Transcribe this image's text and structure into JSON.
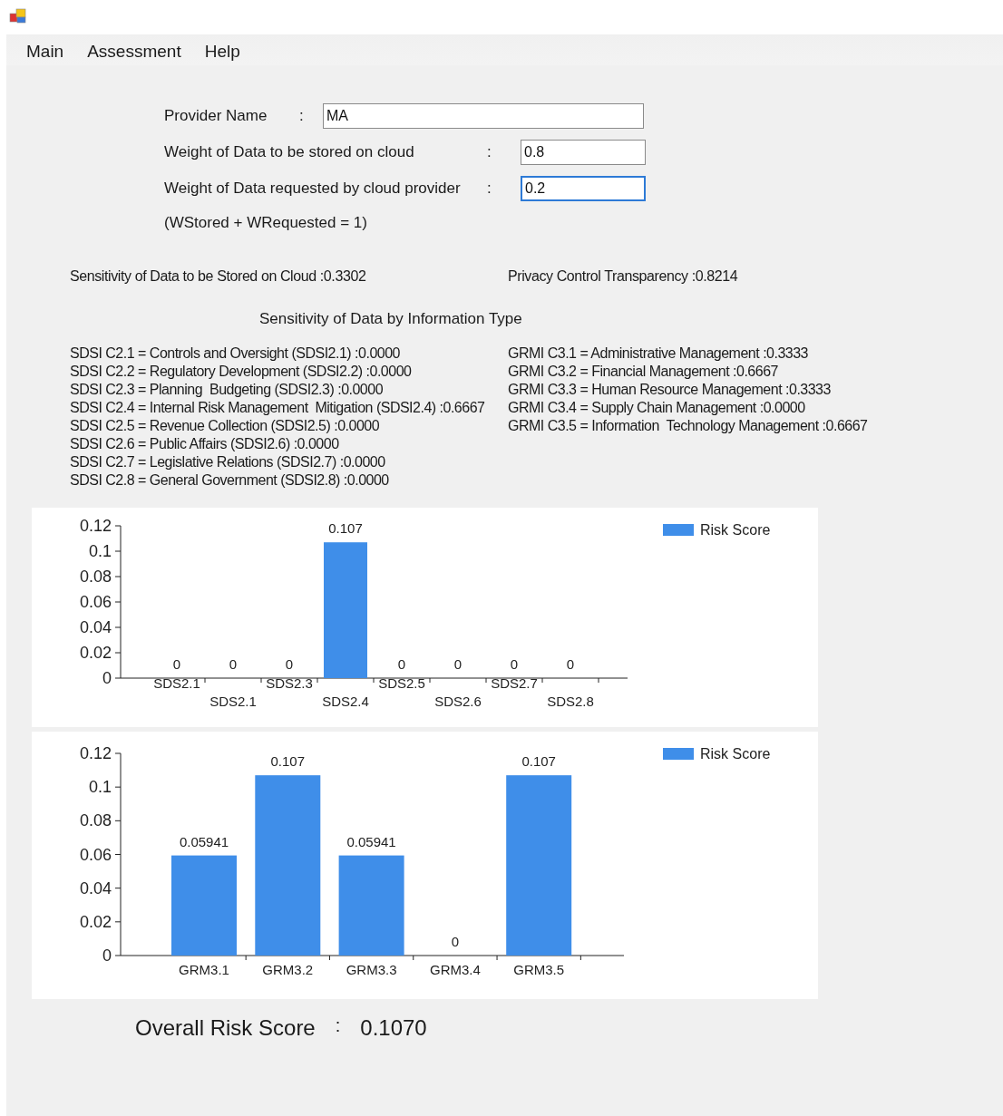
{
  "menu": [
    {
      "label": "Main"
    },
    {
      "label": "Assessment"
    },
    {
      "label": "Help"
    }
  ],
  "form": {
    "fields": [
      {
        "label": "Provider Name",
        "separator": ":",
        "value": "MA",
        "focused": false
      },
      {
        "label": "Weight of Data to be stored on cloud",
        "separator": ":",
        "value": "0.8",
        "focused": false
      },
      {
        "label": "Weight of Data requested by cloud provider",
        "separator": ":",
        "value": "0.2",
        "focused": true
      }
    ],
    "note": "(WStored + WRequested = 1)"
  },
  "summary": {
    "sensitivity": "Sensitivity of Data to be Stored on Cloud :0.3302",
    "transparency": "Privacy Control Transparency :0.8214"
  },
  "section_title": "Sensitivity of Data by Information Type",
  "sdsi_lines": [
    "SDSI C2.1 = Controls and Oversight (SDSI2.1) :0.0000",
    "SDSI C2.2 = Regulatory Development (SDSI2.2) :0.0000",
    "SDSI C2.3 = Planning  Budgeting (SDSI2.3) :0.0000",
    "SDSI C2.4 = Internal Risk Management  Mitigation (SDSI2.4) :0.6667",
    "SDSI C2.5 = Revenue Collection (SDSI2.5) :0.0000",
    "SDSI C2.6 = Public Affairs (SDSI2.6) :0.0000",
    "SDSI C2.7 = Legislative Relations (SDSI2.7) :0.0000",
    "SDSI C2.8 = General Government (SDSI2.8) :0.0000"
  ],
  "grmi_lines": [
    "GRMI C3.1 = Administrative Management :0.3333",
    "GRMI C3.2 = Financial Management :0.6667",
    "GRMI C3.3 = Human Resource Management :0.3333",
    "GRMI C3.4 = Supply Chain Management :0.0000",
    "GRMI C3.5 = Information  Technology Management :0.6667"
  ],
  "charts": [
    {
      "chart_data": {
        "type": "bar",
        "categories": [
          "SDS2.1",
          "SDS2.1",
          "SDS2.3",
          "SDS2.4",
          "SDS2.5",
          "SDS2.6",
          "SDS2.7",
          "SDS2.8"
        ],
        "series": [
          {
            "name": "Risk Score",
            "color": "#3f8ee9",
            "values": [
              0,
              0,
              0,
              0.107,
              0,
              0,
              0,
              0
            ]
          }
        ],
        "ylim": [
          0,
          0.12
        ],
        "yticks": [
          0,
          0.02,
          0.04,
          0.06,
          0.08,
          0.1,
          0.12
        ],
        "data_labels": true
      }
    },
    {
      "chart_data": {
        "type": "bar",
        "categories": [
          "GRM3.1",
          "GRM3.2",
          "GRM3.3",
          "GRM3.4",
          "GRM3.5"
        ],
        "series": [
          {
            "name": "Risk Score",
            "color": "#3f8ee9",
            "values": [
              0.05941,
              0.107,
              0.05941,
              0,
              0.107
            ]
          }
        ],
        "ylim": [
          0,
          0.12
        ],
        "yticks": [
          0,
          0.02,
          0.04,
          0.06,
          0.08,
          0.1,
          0.12
        ],
        "data_labels": true
      }
    }
  ],
  "overall": {
    "label": "Overall Risk Score",
    "separator": ":",
    "value": "0.1070"
  }
}
